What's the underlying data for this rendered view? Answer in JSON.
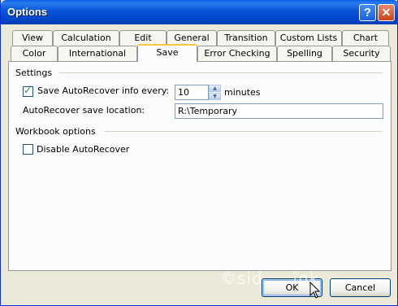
{
  "window": {
    "title": "Options"
  },
  "titlebar": {
    "help_label": "?",
    "close_label": "✕"
  },
  "tabs_row_back": [
    "View",
    "Calculation",
    "Edit",
    "General",
    "Transition",
    "Custom Lists",
    "Chart"
  ],
  "tabs_row_front": [
    "Color",
    "International",
    "Save",
    "Error Checking",
    "Spelling",
    "Security"
  ],
  "active_tab": "Save",
  "settings": {
    "group_label": "Settings",
    "autorecover_checkbox_label": "Save AutoRecover info every:",
    "autorecover_checked": true,
    "minutes_value": "10",
    "minutes_label": "minutes",
    "location_label": "AutoRecover save location:",
    "location_value": "R:\\Temporary"
  },
  "workbook_options": {
    "group_label": "Workbook options",
    "disable_label": "Disable AutoRecover",
    "disable_checked": false
  },
  "buttons": {
    "ok_label": "OK",
    "cancel_label": "Cancel"
  }
}
